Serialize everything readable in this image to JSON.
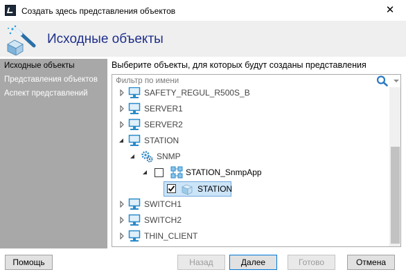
{
  "window": {
    "title": "Создать здесь представления объектов",
    "close_glyph": "✕"
  },
  "header": {
    "title": "Исходные объекты"
  },
  "sidebar": {
    "items": [
      {
        "label": "Исходные объекты",
        "active": true
      },
      {
        "label": "Представления объектов",
        "active": false
      },
      {
        "label": "Аспект представлений",
        "active": false
      }
    ]
  },
  "main": {
    "instruction": "Выберите объекты, для которых будут созданы представления",
    "filter": {
      "placeholder": "Фильтр по имени",
      "value": ""
    }
  },
  "tree": {
    "nodes": [
      {
        "label": "SAFETY_REGUL_R500S_B",
        "icon": "computer-icon",
        "expanded": false,
        "level": 0
      },
      {
        "label": "SERVER1",
        "icon": "computer-icon",
        "expanded": false,
        "level": 0
      },
      {
        "label": "SERVER2",
        "icon": "computer-icon",
        "expanded": false,
        "level": 0
      },
      {
        "label": "STATION",
        "icon": "computer-icon",
        "expanded": true,
        "level": 0
      },
      {
        "label": "SNMP",
        "icon": "gears-icon",
        "expanded": true,
        "level": 1
      },
      {
        "label": "STATION_SnmpApp",
        "icon": "network-app-icon",
        "expanded": true,
        "level": 2,
        "checked": false
      },
      {
        "label": "STATION",
        "icon": "cube-icon",
        "level": 3,
        "checked": true,
        "selected": true
      },
      {
        "label": "SWITCH1",
        "icon": "computer-icon",
        "expanded": false,
        "level": 0
      },
      {
        "label": "SWITCH2",
        "icon": "computer-icon",
        "expanded": false,
        "level": 0
      },
      {
        "label": "THIN_CLIENT",
        "icon": "computer-icon",
        "expanded": false,
        "level": 0
      }
    ]
  },
  "buttons": {
    "help": "Помощь",
    "back": "Назад",
    "next": "Далее",
    "finish": "Готово",
    "cancel": "Отмена"
  },
  "colors": {
    "header_title": "#1f2f8a",
    "sidebar_bg": "#a8a8a8",
    "selection": "#cce4f7"
  }
}
